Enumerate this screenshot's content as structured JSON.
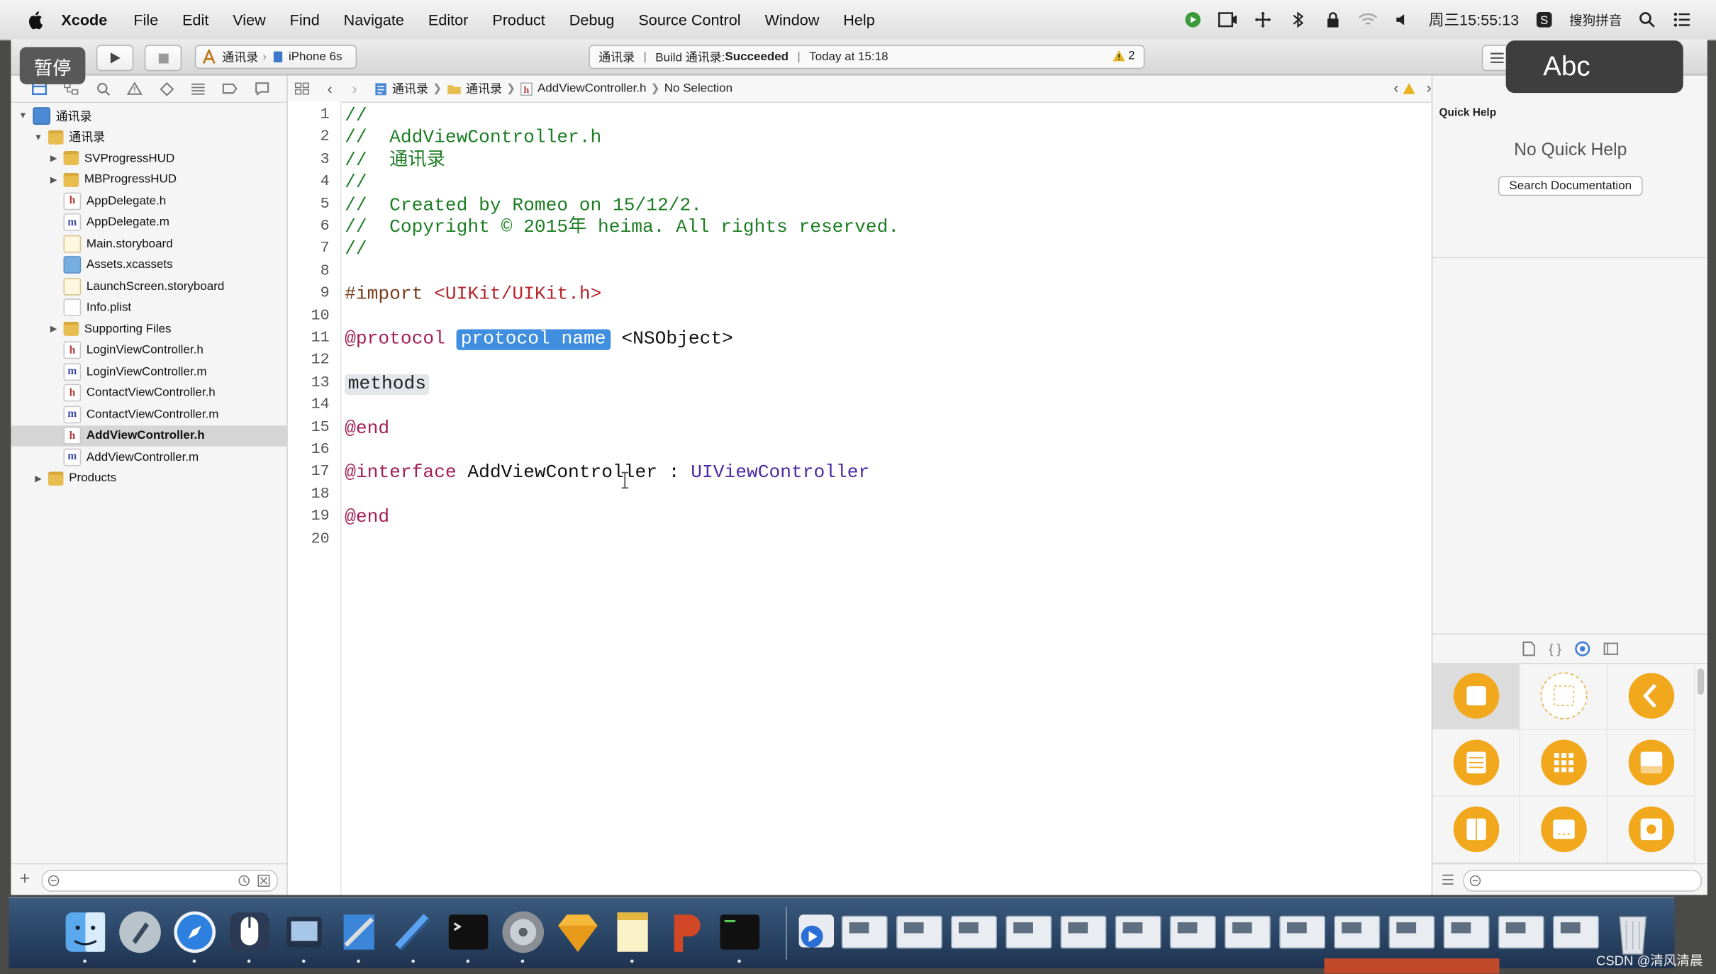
{
  "menubar": {
    "app_name": "Xcode",
    "items": [
      "File",
      "Edit",
      "View",
      "Find",
      "Navigate",
      "Editor",
      "Product",
      "Debug",
      "Source Control",
      "Window",
      "Help"
    ],
    "clock": "周三15:55:13",
    "input_method": "搜狗拼音"
  },
  "overlays": {
    "pause_label": "暂停",
    "input_mode_label": "Abc"
  },
  "toolbar": {
    "scheme": "通讯录",
    "device": "iPhone 6s",
    "status_project": "通讯录",
    "status_build_prefix": "Build 通讯录: ",
    "status_build_result": "Succeeded",
    "status_time": "Today at 15:18",
    "warning_count": "2"
  },
  "navigator": {
    "items": [
      {
        "label": "通讯录",
        "icon": "project-icon",
        "indent": 0,
        "disclosure": "open"
      },
      {
        "label": "通讯录",
        "icon": "folder-icon",
        "indent": 1,
        "disclosure": "open"
      },
      {
        "label": "SVProgressHUD",
        "icon": "folder-icon",
        "indent": 2,
        "disclosure": "closed"
      },
      {
        "label": "MBProgressHUD",
        "icon": "folder-icon",
        "indent": 2,
        "disclosure": "closed"
      },
      {
        "label": "AppDelegate.h",
        "icon": "header-file-icon",
        "indent": 2
      },
      {
        "label": "AppDelegate.m",
        "icon": "implementation-file-icon",
        "indent": 2
      },
      {
        "label": "Main.storyboard",
        "icon": "storyboard-icon",
        "indent": 2
      },
      {
        "label": "Assets.xcassets",
        "icon": "asset-catalog-icon",
        "indent": 2
      },
      {
        "label": "LaunchScreen.storyboard",
        "icon": "storyboard-icon",
        "indent": 2
      },
      {
        "label": "Info.plist",
        "icon": "plist-icon",
        "indent": 2
      },
      {
        "label": "Supporting Files",
        "icon": "folder-icon",
        "indent": 2,
        "disclosure": "closed"
      },
      {
        "label": "LoginViewController.h",
        "icon": "header-file-icon",
        "indent": 2
      },
      {
        "label": "LoginViewController.m",
        "icon": "implementation-file-icon",
        "indent": 2
      },
      {
        "label": "ContactViewController.h",
        "icon": "header-file-icon",
        "indent": 2
      },
      {
        "label": "ContactViewController.m",
        "icon": "implementation-file-icon",
        "indent": 2
      },
      {
        "label": "AddViewController.h",
        "icon": "header-file-icon",
        "indent": 2,
        "selected": true
      },
      {
        "label": "AddViewController.m",
        "icon": "implementation-file-icon",
        "indent": 2
      },
      {
        "label": "Products",
        "icon": "folder-icon",
        "indent": 1,
        "disclosure": "closed"
      }
    ]
  },
  "jumpbar": {
    "crumbs": [
      "通讯录",
      "通讯录",
      "AddViewController.h",
      "No Selection"
    ]
  },
  "editor": {
    "lines": [
      [
        {
          "t": "//",
          "c": "cmt"
        }
      ],
      [
        {
          "t": "//  AddViewController.h",
          "c": "cmt"
        }
      ],
      [
        {
          "t": "//  通讯录",
          "c": "cmt"
        }
      ],
      [
        {
          "t": "//",
          "c": "cmt"
        }
      ],
      [
        {
          "t": "//  Created by Romeo on 15/12/2.",
          "c": "cmt"
        }
      ],
      [
        {
          "t": "//  Copyright © 2015年 heima. All rights reserved.",
          "c": "cmt"
        }
      ],
      [
        {
          "t": "//",
          "c": "cmt"
        }
      ],
      [],
      [
        {
          "t": "#import ",
          "c": "dir"
        },
        {
          "t": "<UIKit/UIKit.h>",
          "c": "str"
        }
      ],
      [],
      [
        {
          "t": "@protocol ",
          "c": "kw"
        },
        {
          "t": "protocol name",
          "c": "ph-sel"
        },
        {
          "t": " <NSObject>",
          "c": "plain"
        }
      ],
      [],
      [
        {
          "t": "methods",
          "c": "ph-unsel"
        }
      ],
      [],
      [
        {
          "t": "@end",
          "c": "kw"
        }
      ],
      [],
      [
        {
          "t": "@interface ",
          "c": "kw"
        },
        {
          "t": "AddViewController : ",
          "c": "plain"
        },
        {
          "t": "UIViewController",
          "c": "typ"
        }
      ],
      [],
      [
        {
          "t": "@end",
          "c": "kw"
        }
      ],
      []
    ]
  },
  "quick_help": {
    "title": "Quick Help",
    "empty_message": "No Quick Help",
    "search_button": "Search Documentation"
  },
  "object_library": {
    "items": [
      "view-controller-icon",
      "storyboard-reference-icon",
      "navigation-controller-icon",
      "table-view-controller-icon",
      "collection-view-controller-icon",
      "tab-bar-controller-icon",
      "page-view-controller-icon",
      "glkit-view-controller-icon",
      "avkit-player-view-controller-icon"
    ]
  },
  "dock": {
    "apps": [
      "finder-icon",
      "launchpad-icon",
      "safari-icon",
      "mouse-icon",
      "photo-booth-icon",
      "xcode-icon",
      "instruments-icon",
      "terminal-icon",
      "system-preferences-icon",
      "sketch-icon",
      "notes-icon",
      "powerpoint-icon",
      "console-icon"
    ]
  },
  "watermark": "CSDN @清风清晨"
}
